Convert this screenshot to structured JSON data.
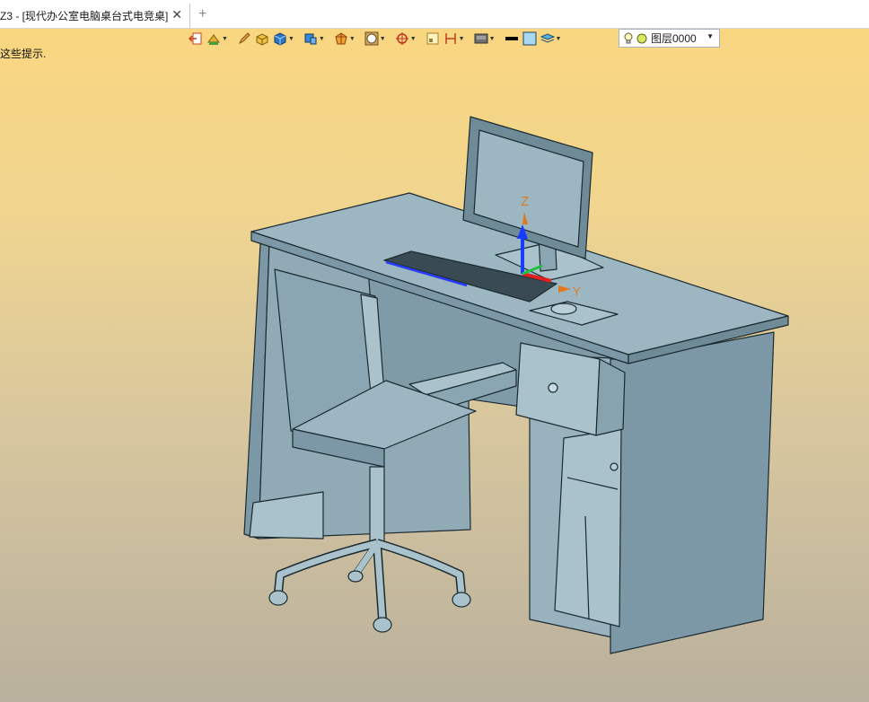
{
  "tab": {
    "title": "Z3 - [现代办公室电脑桌台式电竞桌]",
    "close": "✕",
    "add": "+"
  },
  "toolbar": {
    "icons": [
      "exit-icon",
      "shape-icon",
      "pencil-icon",
      "block-icon",
      "solid-icon",
      "part-icon",
      "orient-icon",
      "render-icon",
      "target-icon",
      "frame-icon",
      "dimension-icon",
      "display-icon",
      "color-swatch-icon",
      "fill-icon",
      "layer-stack-icon"
    ],
    "layer": {
      "label": "图层0000"
    }
  },
  "hint": {
    "text": "这些提示."
  },
  "axes": {
    "z": "Z",
    "y": "Y"
  },
  "colors": {
    "model": "#8aa6b3",
    "model_light": "#a9c2cc",
    "model_dark": "#6f8b98",
    "accent_blue": "#1a3cff",
    "accent_red": "#e02020",
    "accent_green": "#20c040",
    "axis_label": "#e07820"
  }
}
